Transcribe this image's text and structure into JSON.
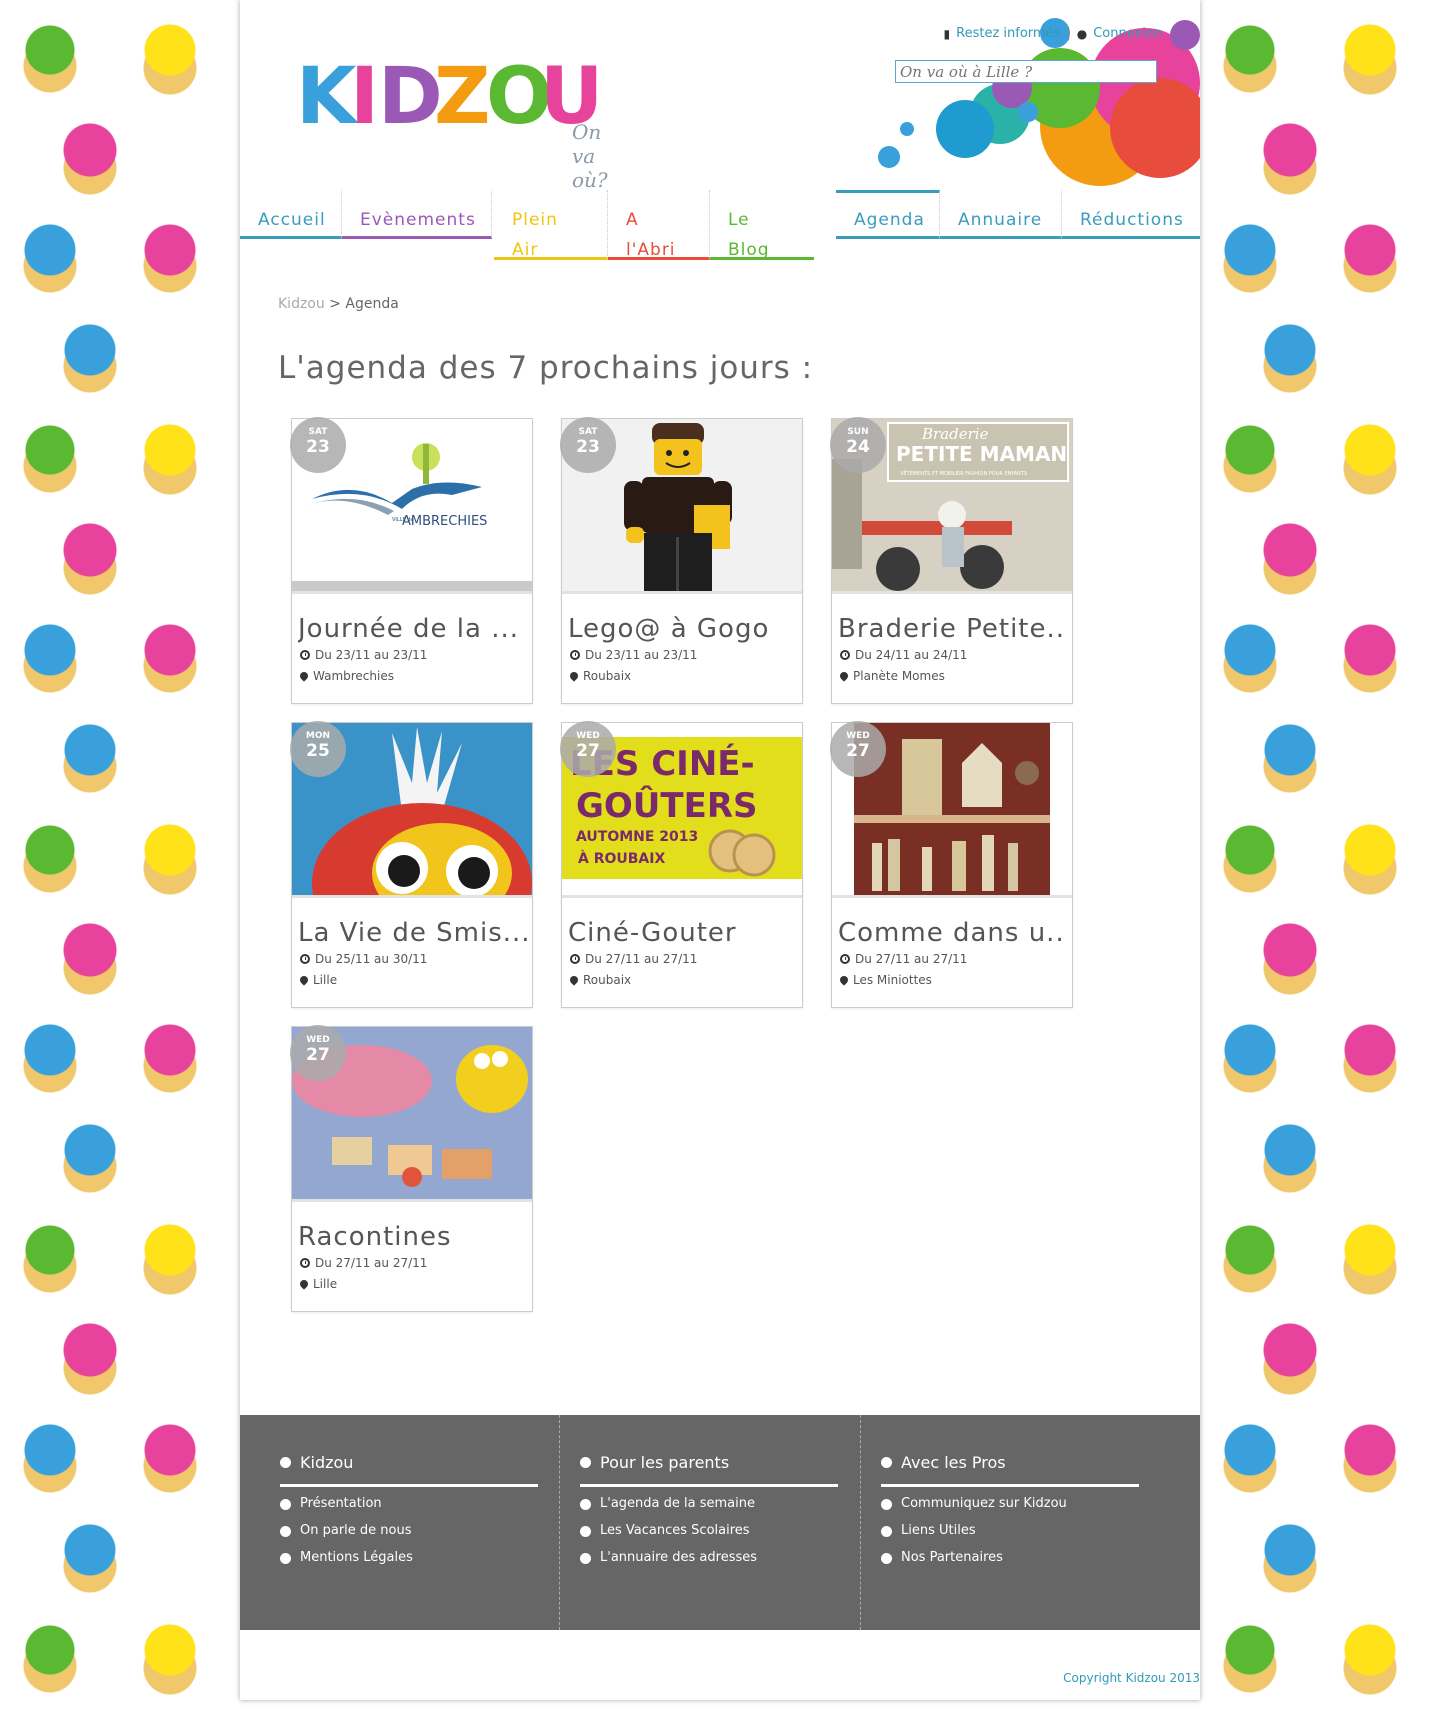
{
  "header": {
    "logo_text": "KIDZOU",
    "logo_tagline": "On va où?",
    "stay_informed": "Restez informés",
    "separator": "|",
    "login": "Connexion",
    "search_placeholder": "On va où à Lille ?"
  },
  "nav": {
    "items": [
      {
        "label": "Accueil",
        "color": "#3a9bbd"
      },
      {
        "label": "Evènements",
        "color": "#9b59b6"
      },
      {
        "label": "Plein Air",
        "color": "#f1c40f"
      },
      {
        "label": "A l'Abri",
        "color": "#e74c3c"
      },
      {
        "label": "Le Blog",
        "color": "#6ab04c"
      },
      {
        "label": "Agenda",
        "color": "#3a9bbd"
      },
      {
        "label": "Annuaire",
        "color": "#3a9bbd"
      },
      {
        "label": "Réductions",
        "color": "#3a9bbd"
      }
    ]
  },
  "breadcrumb": {
    "home": "Kidzou",
    "sep": ">",
    "current": "Agenda"
  },
  "page_title": "L'agenda des 7 prochains jours :",
  "cards": [
    {
      "dow": "SAT",
      "day": "23",
      "title": "Journée de la ...",
      "dates": "Du 23/11 au 23/11",
      "place": "Wambrechies"
    },
    {
      "dow": "SAT",
      "day": "23",
      "title": "Lego@ à Gogo",
      "dates": "Du 23/11 au 23/11",
      "place": "Roubaix"
    },
    {
      "dow": "SUN",
      "day": "24",
      "title": "Braderie Petite..",
      "dates": "Du 24/11 au 24/11",
      "place": "Planète Momes"
    },
    {
      "dow": "MON",
      "day": "25",
      "title": "La Vie de Smis...",
      "dates": "Du 25/11 au 30/11",
      "place": "Lille"
    },
    {
      "dow": "WED",
      "day": "27",
      "title": "Ciné-Gouter",
      "dates": "Du 27/11 au 27/11",
      "place": "Roubaix"
    },
    {
      "dow": "WED",
      "day": "27",
      "title": "Comme dans u..",
      "dates": "Du 27/11 au 27/11",
      "place": "Les Miniottes"
    },
    {
      "dow": "WED",
      "day": "27",
      "title": "Racontines",
      "dates": "Du 27/11 au 27/11",
      "place": "Lille"
    }
  ],
  "thumbs": {
    "wambrechies_text": "AMBRECHIES",
    "wambrechies_small": "VILLE de",
    "braderie_script": "Braderie",
    "braderie_title": "PETITE MAMAN",
    "braderie_sub": "VÊTEMENTS ET MOBILIER FASHION POUR ENFANTS",
    "cine_line1": "LES CINÉ-",
    "cine_line2": "GOÛTERS",
    "cine_line3": "AUTOMNE 2013",
    "cine_line4": "À ROUBAIX"
  },
  "footer": {
    "cols": [
      {
        "title": "Kidzou",
        "links": [
          "Présentation",
          "On parle de nous",
          "Mentions Légales"
        ]
      },
      {
        "title": "Pour les parents",
        "links": [
          "L'agenda de la semaine",
          "Les Vacances Scolaires",
          "L'annuaire des adresses"
        ]
      },
      {
        "title": "Avec les Pros",
        "links": [
          "Communiquez sur Kidzou",
          "Liens Utiles",
          "Nos Partenaires"
        ]
      }
    ],
    "copyright": "Copyright Kidzou 2013"
  },
  "colors": {
    "accent": "#2f9ab9",
    "footer_bg": "#666666"
  }
}
